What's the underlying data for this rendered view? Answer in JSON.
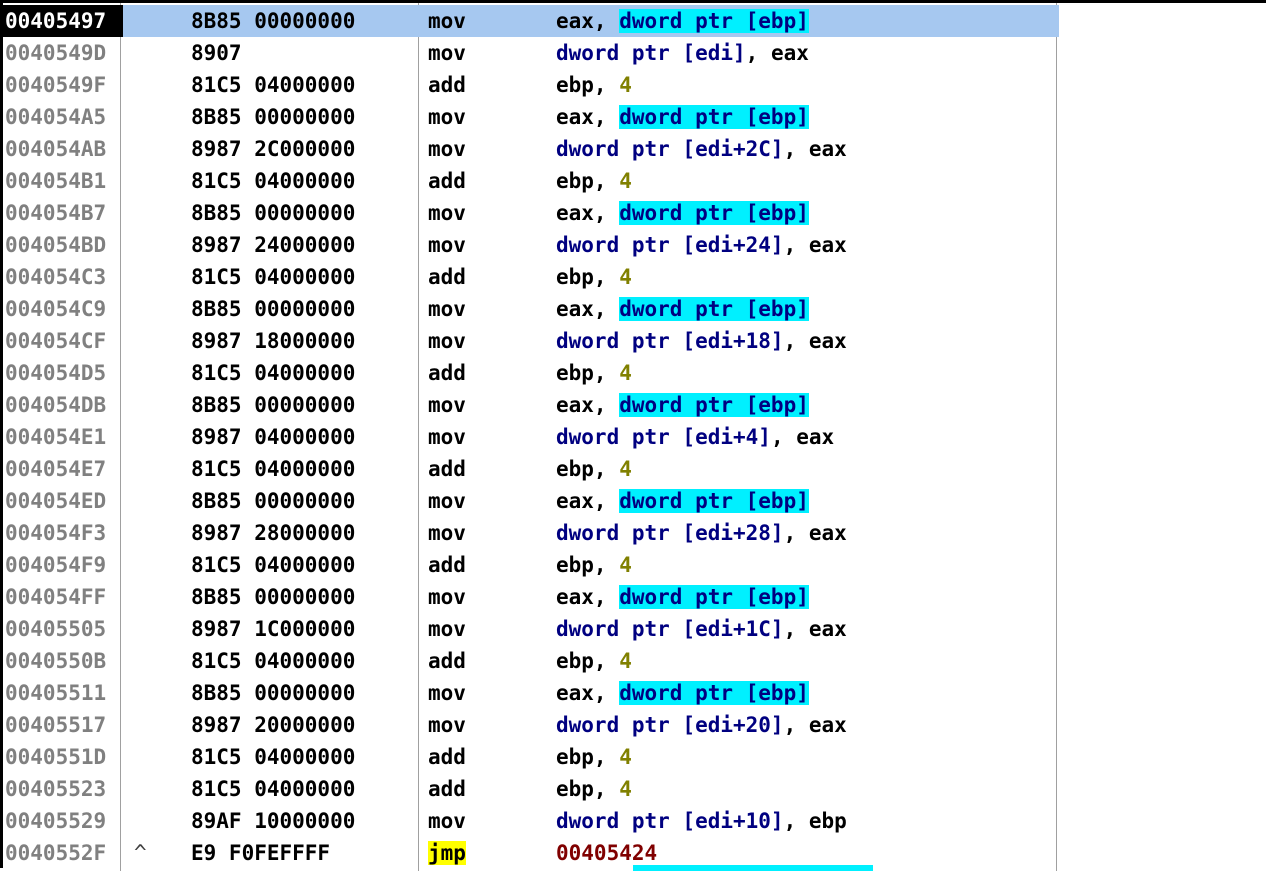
{
  "window": {
    "type": "disassembly-listing"
  },
  "colors": {
    "selected_address_bg": "#000000",
    "selected_row_band": "#a6c8f0",
    "address_text": "#808080",
    "memory_operand": "#000080",
    "memory_highlight": "#00f0ff",
    "immediate": "#808000",
    "jump_target": "#800000",
    "jmp_highlight": "#ffff00"
  },
  "rows": [
    {
      "address": "00405497",
      "jump": "",
      "hex": "8B85 00000000",
      "mnemonic": "mov",
      "ops": [
        {
          "t": "eax, ",
          "k": "reg"
        },
        {
          "t": "dword ptr [ebp]",
          "k": "memhl"
        }
      ],
      "selected": true
    },
    {
      "address": "0040549D",
      "jump": "",
      "hex": "8907",
      "mnemonic": "mov",
      "ops": [
        {
          "t": "dword ptr [edi]",
          "k": "mem"
        },
        {
          "t": ", eax",
          "k": "reg"
        }
      ]
    },
    {
      "address": "0040549F",
      "jump": "",
      "hex": "81C5 04000000",
      "mnemonic": "add",
      "ops": [
        {
          "t": "ebp, ",
          "k": "reg"
        },
        {
          "t": "4",
          "k": "imm"
        }
      ]
    },
    {
      "address": "004054A5",
      "jump": "",
      "hex": "8B85 00000000",
      "mnemonic": "mov",
      "ops": [
        {
          "t": "eax, ",
          "k": "reg"
        },
        {
          "t": "dword ptr [ebp]",
          "k": "memhl"
        }
      ]
    },
    {
      "address": "004054AB",
      "jump": "",
      "hex": "8987 2C000000",
      "mnemonic": "mov",
      "ops": [
        {
          "t": "dword ptr [edi+2C]",
          "k": "mem"
        },
        {
          "t": ", eax",
          "k": "reg"
        }
      ]
    },
    {
      "address": "004054B1",
      "jump": "",
      "hex": "81C5 04000000",
      "mnemonic": "add",
      "ops": [
        {
          "t": "ebp, ",
          "k": "reg"
        },
        {
          "t": "4",
          "k": "imm"
        }
      ]
    },
    {
      "address": "004054B7",
      "jump": "",
      "hex": "8B85 00000000",
      "mnemonic": "mov",
      "ops": [
        {
          "t": "eax, ",
          "k": "reg"
        },
        {
          "t": "dword ptr [ebp]",
          "k": "memhl"
        }
      ]
    },
    {
      "address": "004054BD",
      "jump": "",
      "hex": "8987 24000000",
      "mnemonic": "mov",
      "ops": [
        {
          "t": "dword ptr [edi+24]",
          "k": "mem"
        },
        {
          "t": ", eax",
          "k": "reg"
        }
      ]
    },
    {
      "address": "004054C3",
      "jump": "",
      "hex": "81C5 04000000",
      "mnemonic": "add",
      "ops": [
        {
          "t": "ebp, ",
          "k": "reg"
        },
        {
          "t": "4",
          "k": "imm"
        }
      ]
    },
    {
      "address": "004054C9",
      "jump": "",
      "hex": "8B85 00000000",
      "mnemonic": "mov",
      "ops": [
        {
          "t": "eax, ",
          "k": "reg"
        },
        {
          "t": "dword ptr [ebp]",
          "k": "memhl"
        }
      ]
    },
    {
      "address": "004054CF",
      "jump": "",
      "hex": "8987 18000000",
      "mnemonic": "mov",
      "ops": [
        {
          "t": "dword ptr [edi+18]",
          "k": "mem"
        },
        {
          "t": ", eax",
          "k": "reg"
        }
      ]
    },
    {
      "address": "004054D5",
      "jump": "",
      "hex": "81C5 04000000",
      "mnemonic": "add",
      "ops": [
        {
          "t": "ebp, ",
          "k": "reg"
        },
        {
          "t": "4",
          "k": "imm"
        }
      ]
    },
    {
      "address": "004054DB",
      "jump": "",
      "hex": "8B85 00000000",
      "mnemonic": "mov",
      "ops": [
        {
          "t": "eax, ",
          "k": "reg"
        },
        {
          "t": "dword ptr [ebp]",
          "k": "memhl"
        }
      ]
    },
    {
      "address": "004054E1",
      "jump": "",
      "hex": "8987 04000000",
      "mnemonic": "mov",
      "ops": [
        {
          "t": "dword ptr [edi+4]",
          "k": "mem"
        },
        {
          "t": ", eax",
          "k": "reg"
        }
      ]
    },
    {
      "address": "004054E7",
      "jump": "",
      "hex": "81C5 04000000",
      "mnemonic": "add",
      "ops": [
        {
          "t": "ebp, ",
          "k": "reg"
        },
        {
          "t": "4",
          "k": "imm"
        }
      ]
    },
    {
      "address": "004054ED",
      "jump": "",
      "hex": "8B85 00000000",
      "mnemonic": "mov",
      "ops": [
        {
          "t": "eax, ",
          "k": "reg"
        },
        {
          "t": "dword ptr [ebp]",
          "k": "memhl"
        }
      ]
    },
    {
      "address": "004054F3",
      "jump": "",
      "hex": "8987 28000000",
      "mnemonic": "mov",
      "ops": [
        {
          "t": "dword ptr [edi+28]",
          "k": "mem"
        },
        {
          "t": ", eax",
          "k": "reg"
        }
      ]
    },
    {
      "address": "004054F9",
      "jump": "",
      "hex": "81C5 04000000",
      "mnemonic": "add",
      "ops": [
        {
          "t": "ebp, ",
          "k": "reg"
        },
        {
          "t": "4",
          "k": "imm"
        }
      ]
    },
    {
      "address": "004054FF",
      "jump": "",
      "hex": "8B85 00000000",
      "mnemonic": "mov",
      "ops": [
        {
          "t": "eax, ",
          "k": "reg"
        },
        {
          "t": "dword ptr [ebp]",
          "k": "memhl"
        }
      ]
    },
    {
      "address": "00405505",
      "jump": "",
      "hex": "8987 1C000000",
      "mnemonic": "mov",
      "ops": [
        {
          "t": "dword ptr [edi+1C]",
          "k": "mem"
        },
        {
          "t": ", eax",
          "k": "reg"
        }
      ]
    },
    {
      "address": "0040550B",
      "jump": "",
      "hex": "81C5 04000000",
      "mnemonic": "add",
      "ops": [
        {
          "t": "ebp, ",
          "k": "reg"
        },
        {
          "t": "4",
          "k": "imm"
        }
      ]
    },
    {
      "address": "00405511",
      "jump": "",
      "hex": "8B85 00000000",
      "mnemonic": "mov",
      "ops": [
        {
          "t": "eax, ",
          "k": "reg"
        },
        {
          "t": "dword ptr [ebp]",
          "k": "memhl"
        }
      ]
    },
    {
      "address": "00405517",
      "jump": "",
      "hex": "8987 20000000",
      "mnemonic": "mov",
      "ops": [
        {
          "t": "dword ptr [edi+20]",
          "k": "mem"
        },
        {
          "t": ", eax",
          "k": "reg"
        }
      ]
    },
    {
      "address": "0040551D",
      "jump": "",
      "hex": "81C5 04000000",
      "mnemonic": "add",
      "ops": [
        {
          "t": "ebp, ",
          "k": "reg"
        },
        {
          "t": "4",
          "k": "imm"
        }
      ]
    },
    {
      "address": "00405523",
      "jump": "",
      "hex": "81C5 04000000",
      "mnemonic": "add",
      "ops": [
        {
          "t": "ebp, ",
          "k": "reg"
        },
        {
          "t": "4",
          "k": "imm"
        }
      ]
    },
    {
      "address": "00405529",
      "jump": "",
      "hex": "89AF 10000000",
      "mnemonic": "mov",
      "ops": [
        {
          "t": "dword ptr [edi+10]",
          "k": "mem"
        },
        {
          "t": ", ebp",
          "k": "reg"
        }
      ]
    },
    {
      "address": "0040552F",
      "jump": "^",
      "hex": "E9 F0FEFFFF",
      "mnemonic": "jmp",
      "ops": [
        {
          "t": "00405424",
          "k": "addr"
        }
      ],
      "jmp": true
    }
  ]
}
